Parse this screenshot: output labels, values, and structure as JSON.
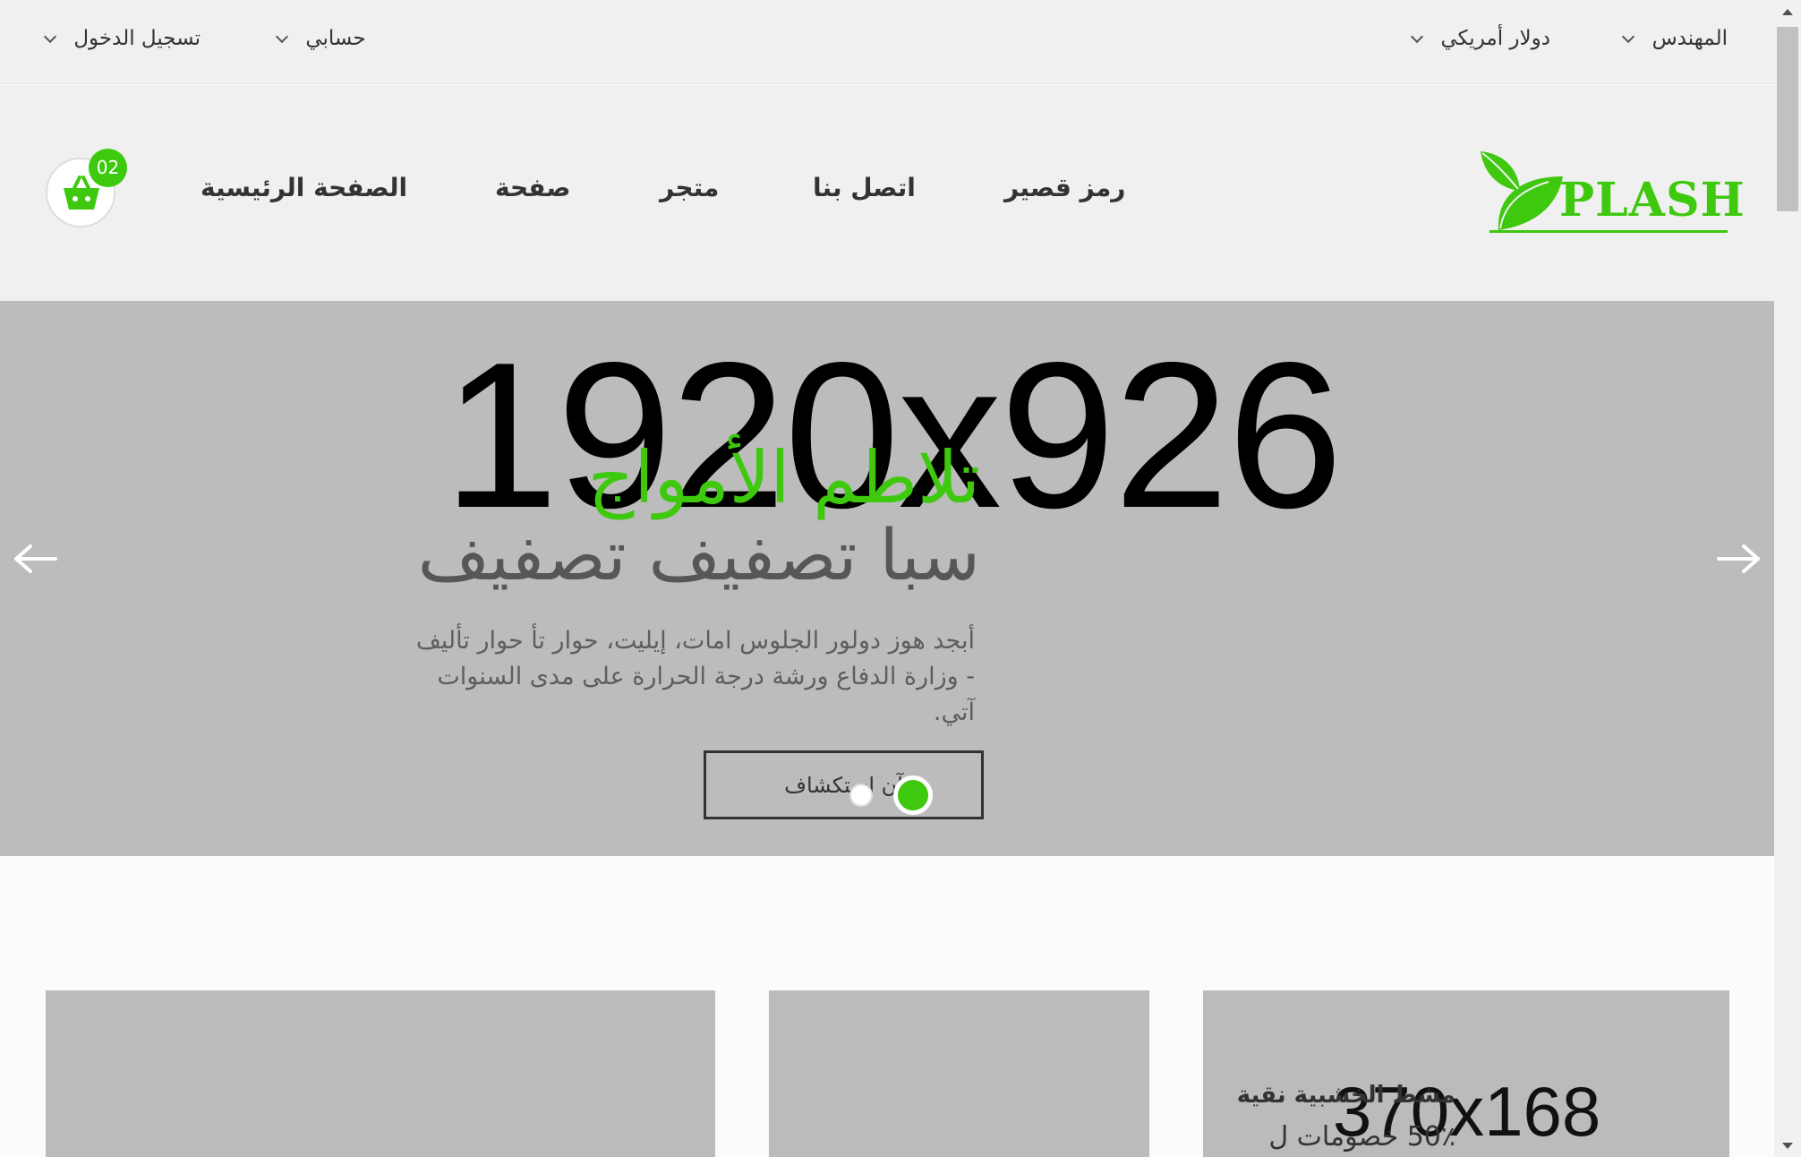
{
  "topbar": {
    "language": "المهندس",
    "currency": "دولار أمريكي",
    "account": "حسابي",
    "login": "تسجيل الدخول"
  },
  "header": {
    "logo_text": "PLASH",
    "nav": {
      "shortcode": "رمز قصير",
      "contact": "اتصل بنا",
      "shop": "متجر",
      "page": "صفحة",
      "home": "الصفحة الرئيسية"
    },
    "cart_count": "02"
  },
  "hero": {
    "placeholder": "1920x926",
    "subtitle": "تلاطم الأمواج",
    "title": "سبا تصفيف تصفيف",
    "description": "أبجد هوز دولور الجلوس امات، إيليت، حوار تأ حوار تأليف - وزارة الدفاع ورشة درجة الحرارة على مدى السنوات آتي.",
    "button_label": "آن استكشاف",
    "slide_count": 2,
    "active_slide": 1
  },
  "banners": [
    {
      "title": "",
      "offer": "",
      "placeholder": ""
    },
    {
      "title": "",
      "offer": "",
      "placeholder": ""
    },
    {
      "placeholder": "370x168",
      "title": "مشط الخشبية نقية",
      "offer": "50٪ خصومات ل"
    }
  ],
  "colors": {
    "accent": "#3ec90f",
    "topbar_bg": "#f0f0f0",
    "hero_bg": "#bcbcbc",
    "placeholder_bg": "#bbbbbb"
  }
}
